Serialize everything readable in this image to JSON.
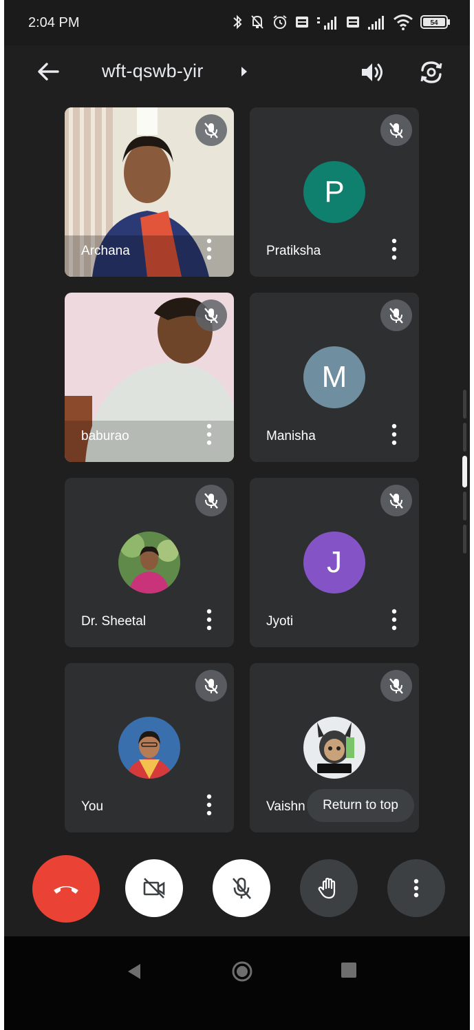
{
  "status_bar": {
    "time": "2:04 PM",
    "battery": "54"
  },
  "header": {
    "meeting_code": "wft-qswb-yir"
  },
  "participants": [
    {
      "name": "Archana",
      "type": "video",
      "muted": true
    },
    {
      "name": "Pratiksha",
      "type": "initial",
      "initial": "P",
      "color": "#0f7f6e",
      "muted": true
    },
    {
      "name": "baburao",
      "type": "video",
      "muted": true
    },
    {
      "name": "Manisha",
      "type": "initial",
      "initial": "M",
      "color": "#6f8fa0",
      "muted": true
    },
    {
      "name": "Dr. Sheetal",
      "type": "photo",
      "muted": true
    },
    {
      "name": "Jyoti",
      "type": "initial",
      "initial": "J",
      "color": "#8454c6",
      "muted": true
    },
    {
      "name": "You",
      "type": "photo",
      "muted": true
    },
    {
      "name": "Vaishn",
      "type": "photo",
      "muted": true
    }
  ],
  "return_to_top": "Return to top",
  "controls": {
    "end_call_color": "#ea4335",
    "items": [
      "end-call",
      "camera-off",
      "mic-off",
      "raise-hand",
      "more-options"
    ]
  }
}
